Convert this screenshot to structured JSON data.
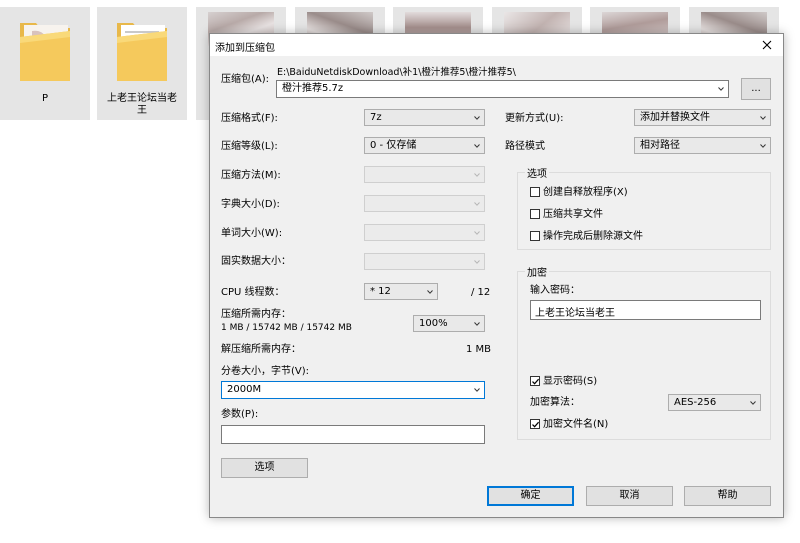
{
  "explorer": {
    "tiles": [
      {
        "label": "P"
      },
      {
        "label": "上老王论坛当老\n王"
      }
    ]
  },
  "dialog": {
    "title": "添加到压缩包",
    "archive_label": "压缩包(A):",
    "archive_path": "E:\\BaiduNetdiskDownload\\补1\\橙汁推荐5\\橙汁推荐5\\",
    "archive_name": "橙汁推荐5.7z",
    "browse_label": "...",
    "format_label": "压缩格式(F):",
    "format_value": "7z",
    "level_label": "压缩等级(L):",
    "level_value": "0 - 仅存储",
    "method_label": "压缩方法(M):",
    "dict_label": "字典大小(D):",
    "word_label": "单词大小(W):",
    "solid_label": "固实数据大小：",
    "cpu_label": "CPU 线程数：",
    "cpu_value": "* 12",
    "cpu_total": "/ 12",
    "mem_compress_label": "压缩所需内存：",
    "mem_compress_detail": "1 MB / 15742 MB / 15742 MB",
    "mem_percent": "100%",
    "mem_decompress_label": "解压缩所需内存：",
    "mem_decompress_value": "1 MB",
    "split_label": "分卷大小，字节(V):",
    "split_value": "2000M",
    "params_label": "参数(P):",
    "params_value": "",
    "options_button": "选项",
    "update_label": "更新方式(U):",
    "update_value": "添加并替换文件",
    "path_label": "路径模式",
    "path_value": "相对路径",
    "options_group": {
      "title": "选项",
      "sfx": "创建自释放程序(X)",
      "shared": "压缩共享文件",
      "delete": "操作完成后删除源文件"
    },
    "encrypt_group": {
      "title": "加密",
      "pwd_label": "输入密码：",
      "pwd_value": "上老王论坛当老王",
      "show_pwd": "显示密码(S)",
      "algo_label": "加密算法：",
      "algo_value": "AES-256",
      "encrypt_names": "加密文件名(N)"
    },
    "ok": "确定",
    "cancel": "取消",
    "help": "帮助"
  }
}
